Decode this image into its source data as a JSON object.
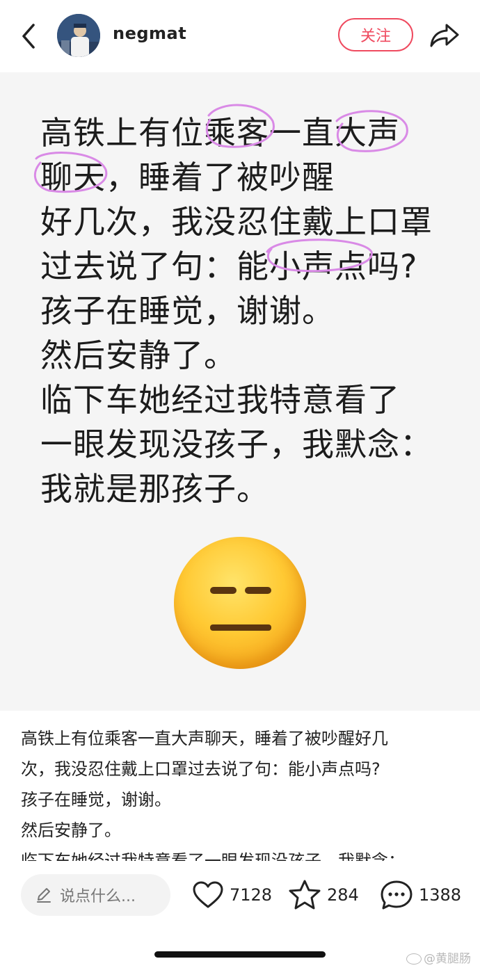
{
  "header": {
    "username": "negmat",
    "follow_label": "关注",
    "icons": [
      "back-chevron-icon",
      "share-icon"
    ]
  },
  "post_image": {
    "lines": [
      "高铁上有位乘客一直大声",
      "聊天，睡着了被吵醒",
      "好几次，我没忍住戴上口罩",
      "过去说了句：能小声点吗?",
      "孩子在睡觉，谢谢。",
      "然后安静了。",
      "临下车她经过我特意看了",
      "一眼发现没孩子，我默念：",
      "我就是那孩子。"
    ],
    "highlight_color": "#d98ae6",
    "emoji": "expressionless-face-emoji"
  },
  "caption": {
    "lines": [
      "高铁上有位乘客一直大声聊天，睡着了被吵醒好几",
      "次，我没忍住戴上口罩过去说了句：能小声点吗?",
      "孩子在睡觉，谢谢。",
      "然后安静了。",
      "临下车她经过我特意看了一眼发现没孩子，我默念："
    ]
  },
  "bottom_bar": {
    "comment_placeholder": "说点什么...",
    "likes": "7128",
    "favorites": "284",
    "comments": "1388"
  },
  "watermark": "@黄腿肠",
  "colors": {
    "accent": "#ef4a5f",
    "background": "#f5f5f5"
  }
}
